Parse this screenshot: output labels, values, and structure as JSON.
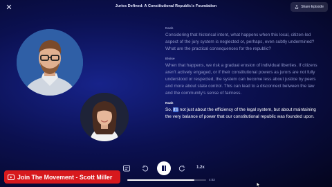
{
  "header": {
    "title": "Juries Defined: A Constitutional Republic's Foundation",
    "share_label": "Share Episode"
  },
  "icons": {
    "close": "close-icon",
    "share": "share-icon",
    "transcript": "transcript-icon",
    "rewind": "rewind-icon",
    "pause": "pause-icon",
    "forward": "forward-icon",
    "banner": "youtube-icon"
  },
  "transcript": [
    {
      "speaker": "Noah",
      "text": "Considering that historical intent, what happens when this local, citizen-led aspect of the jury system is neglected or, perhaps, even subtly undermined? What are the practical consequences for the republic?",
      "state": "past"
    },
    {
      "speaker": "Eloise",
      "text": "When that happens, we risk a gradual erosion of individual liberties. If citizens aren't actively engaged, or if their constitutional powers as jurors are not fully understood or respected, the system can become less about justice by peers and more about state control. This can lead to a disconnect between the law and the community's sense of fairness.",
      "state": "past"
    },
    {
      "speaker": "Noah",
      "text_before": "So, ",
      "highlight": "it's",
      "text_after": " not just about the efficiency of the legal system, but about maintaining the very balance of power that our constitutional republic was founded upon.",
      "state": "current"
    }
  ],
  "player": {
    "speed": "1.2x",
    "remaining": "4:02",
    "progress_fraction": 0.85
  },
  "banner": {
    "label": "Join The Movement - Scott Miller",
    "color": "#d7191d"
  },
  "colors": {
    "accent_highlight": "#4b74d8",
    "background": "#0b1050"
  }
}
